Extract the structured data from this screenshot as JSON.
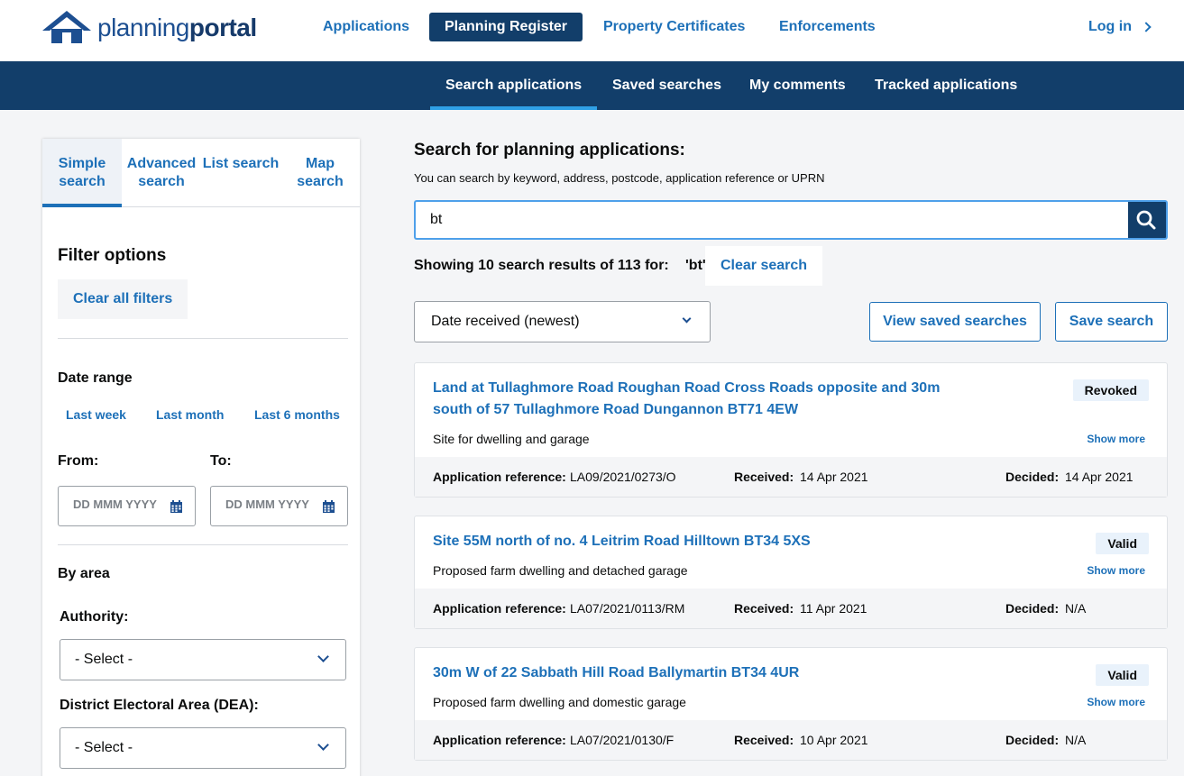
{
  "header": {
    "logo": {
      "part1": "planning",
      "part2": "portal"
    },
    "nav": [
      {
        "label": "Applications"
      },
      {
        "label": "Planning Register"
      },
      {
        "label": "Property Certificates"
      },
      {
        "label": "Enforcements"
      }
    ],
    "login": "Log in"
  },
  "subnav": [
    {
      "label": "Search applications"
    },
    {
      "label": "Saved searches"
    },
    {
      "label": "My comments"
    },
    {
      "label": "Tracked applications"
    }
  ],
  "sidebar": {
    "tabs": [
      {
        "label": "Simple search"
      },
      {
        "label": "Advanced search"
      },
      {
        "label": "List search"
      },
      {
        "label": "Map search"
      }
    ],
    "filter_title": "Filter options",
    "clear_filters": "Clear all filters",
    "date_range_label": "Date range",
    "quick_ranges": [
      "Last week",
      "Last month",
      "Last 6 months"
    ],
    "from_label": "From:",
    "to_label": "To:",
    "date_placeholder": "DD MMM YYYY",
    "by_area_label": "By area",
    "authority_label": "Authority:",
    "authority_value": "- Select -",
    "dea_label": "District Electoral Area (DEA):",
    "dea_value": "- Select -"
  },
  "main": {
    "heading": "Search for planning applications:",
    "hint": "You can search by keyword, address, postcode, application reference or UPRN",
    "search_value": "bt",
    "results_text": "Showing 10 search results of 113 for:",
    "query_text": "'bt'",
    "clear_search": "Clear search",
    "sort_value": "Date received (newest)",
    "view_saved": "View saved searches",
    "save_search": "Save search",
    "labels": {
      "ref": "Application reference:",
      "received": "Received:",
      "decided": "Decided:",
      "show_more": "Show more"
    },
    "results": [
      {
        "title": "Land at Tullaghmore Road Roughan Road Cross Roads opposite and 30m south of 57 Tullaghmore Road Dungannon BT71 4EW",
        "status": "Revoked",
        "description": "Site for dwelling and garage",
        "reference": "LA09/2021/0273/O",
        "received": "14 Apr 2021",
        "decided": "14 Apr 2021"
      },
      {
        "title": "Site 55M north of no. 4 Leitrim Road Hilltown BT34 5XS",
        "status": "Valid",
        "description": "Proposed farm dwelling and detached garage",
        "reference": "LA07/2021/0113/RM",
        "received": "11 Apr 2021",
        "decided": "N/A"
      },
      {
        "title": "30m W of 22 Sabbath Hill Road Ballymartin BT34 4UR",
        "status": "Valid",
        "description": "Proposed farm dwelling and domestic garage",
        "reference": "LA07/2021/0130/F",
        "received": "10 Apr 2021",
        "decided": "N/A"
      }
    ]
  },
  "colors": {
    "brand": "#123e6a",
    "link": "#1d70b8",
    "focus": "#4ea0ea"
  },
  "icons": {
    "search": "search-icon",
    "calendar": "calendar-icon",
    "chevron": "chevron-down-icon",
    "login": "chevron-right-icon",
    "logo": "house-logo-icon"
  }
}
